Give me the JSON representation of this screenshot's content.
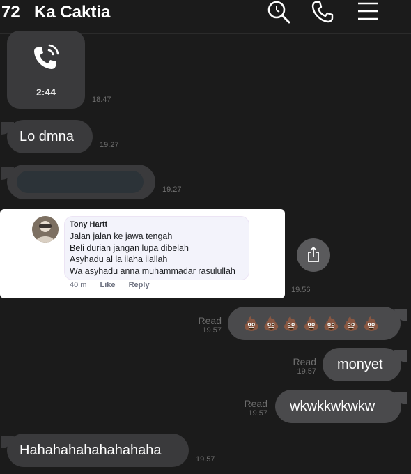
{
  "header": {
    "count": "72",
    "contact_name": "Ka Caktia",
    "icons": [
      "search-icon",
      "phone-icon",
      "menu-icon"
    ]
  },
  "messages": {
    "call": {
      "duration": "2:44",
      "time": "18.47"
    },
    "lo_dmna": {
      "text": "Lo dmna",
      "time": "19.27"
    },
    "redacted": {
      "time": "19.27"
    },
    "fb_screenshot": {
      "name": "Tony Hartt",
      "lines": [
        "Jalan jalan ke jawa tengah",
        "Beli durian jangan lupa dibelah",
        "Asyhadu al la ilaha ilallah",
        "Wa asyhadu anna muhammadar rasulullah"
      ],
      "age": "40 m",
      "like": "Like",
      "reply": "Reply",
      "time": "19.56"
    },
    "poop": {
      "text": "💩💩💩💩💩💩💩",
      "status": "Read",
      "time": "19.57"
    },
    "monyet": {
      "text": "monyet",
      "status": "Read",
      "time": "19.57"
    },
    "wkwk": {
      "text": "wkwkkwkwkw",
      "status": "Read",
      "time": "19.57"
    },
    "haha": {
      "text": "Hahahahahahahahaha",
      "time": "19.57"
    }
  },
  "colors": {
    "background": "#1b1b1b",
    "incoming_bubble": "#3a3a3c",
    "outgoing_bubble": "#4a4a4c",
    "timestamp": "#6e6e6e"
  }
}
